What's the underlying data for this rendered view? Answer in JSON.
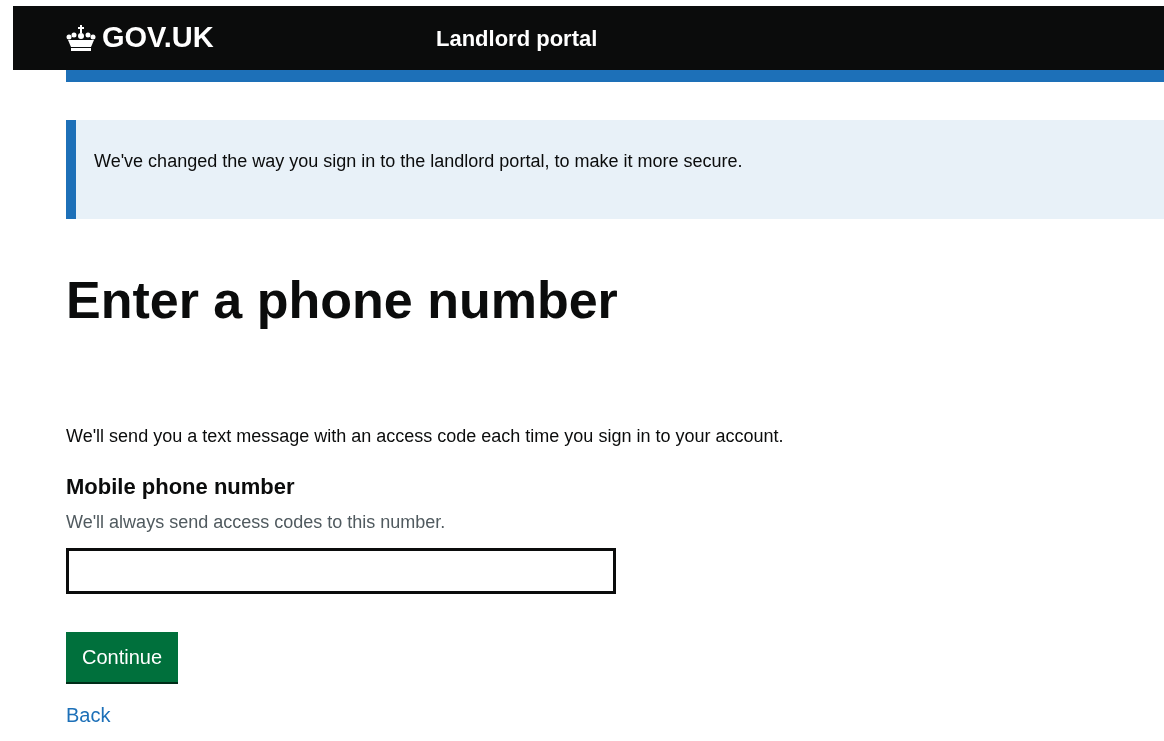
{
  "header": {
    "logo": "GOV.UK",
    "service_name": "Landlord portal"
  },
  "notice": {
    "text": "We've changed the way you sign in to the landlord portal, to make it more secure."
  },
  "heading": "Enter a phone number",
  "intro": "We'll send you a text message with an access code each time you sign in to your account.",
  "field": {
    "label": "Mobile phone number",
    "hint": "We'll always send access codes to this number."
  },
  "buttons": [
    {
      "label": "Continue"
    }
  ],
  "back_link": "Back"
}
